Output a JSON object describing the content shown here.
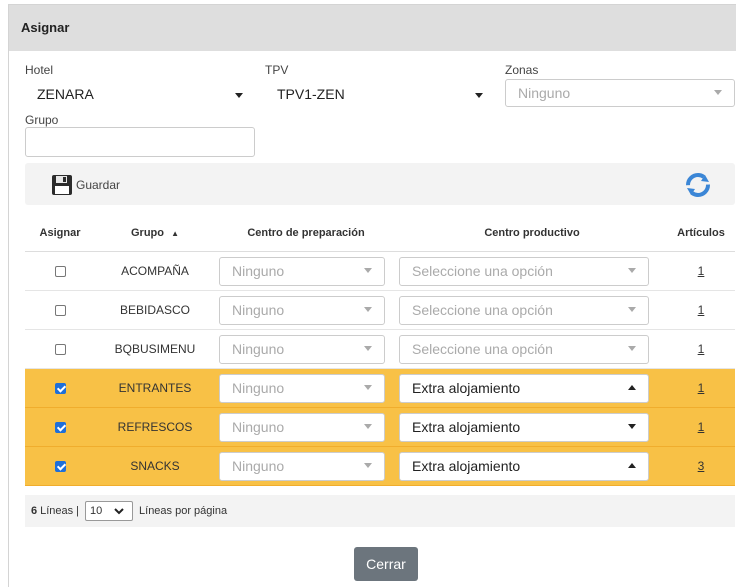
{
  "dialog": {
    "title": "Asignar"
  },
  "filters": {
    "hotel": {
      "label": "Hotel",
      "value": "ZENARA"
    },
    "tpv": {
      "label": "TPV",
      "value": "TPV1-ZEN"
    },
    "zonas": {
      "label": "Zonas",
      "value": "Ninguno"
    },
    "grupo": {
      "label": "Grupo",
      "value": ""
    }
  },
  "toolbar": {
    "save_label": "Guardar",
    "save_icon": "floppy-disk-icon",
    "refresh_icon": "refresh-icon"
  },
  "table": {
    "headers": {
      "asignar": "Asignar",
      "grupo": "Grupo",
      "sort_indicator": "▲",
      "centro_preparacion": "Centro de preparación",
      "centro_productivo": "Centro productivo",
      "articulos": "Artículos"
    },
    "rows": [
      {
        "checked": false,
        "grupo": "ACOMPAÑA",
        "centro_preparacion": "Ninguno",
        "centro_productivo": "Seleccione una opción",
        "articulos": "1"
      },
      {
        "checked": false,
        "grupo": "BEBIDASCO",
        "centro_preparacion": "Ninguno",
        "centro_productivo": "Seleccione una opción",
        "articulos": "1"
      },
      {
        "checked": false,
        "grupo": "BQBUSIMENU",
        "centro_preparacion": "Ninguno",
        "centro_productivo": "Seleccione una opción",
        "articulos": "1"
      },
      {
        "checked": true,
        "grupo": "ENTRANTES",
        "centro_preparacion": "Ninguno",
        "centro_productivo": "Extra alojamiento",
        "articulos": "1"
      },
      {
        "checked": true,
        "grupo": "REFRESCOS",
        "centro_preparacion": "Ninguno",
        "centro_productivo": "Extra alojamiento",
        "articulos": "1"
      },
      {
        "checked": true,
        "grupo": "SNACKS",
        "centro_preparacion": "Ninguno",
        "centro_productivo": "Extra alojamiento",
        "articulos": "3"
      }
    ]
  },
  "footer": {
    "count": "6",
    "lines_label": "Líneas",
    "separator": "|",
    "per_page": "10",
    "per_page_label": "Líneas por página"
  },
  "actions": {
    "close_label": "Cerrar"
  },
  "colors": {
    "selected_row": "#f8c146",
    "header_bar": "#dedede",
    "close_button": "#6c757d",
    "checkbox_checked": "#1e6fd9"
  }
}
